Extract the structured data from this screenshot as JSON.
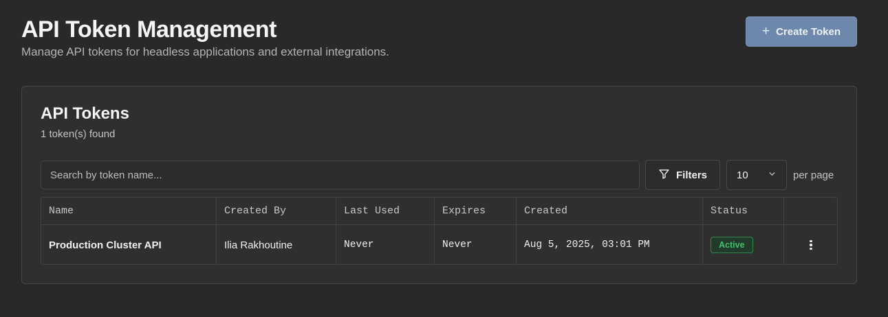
{
  "header": {
    "title": "API Token Management",
    "subtitle": "Manage API tokens for headless applications and external integrations.",
    "create_button": {
      "label": "Create Token",
      "icon": "plus-icon"
    }
  },
  "card": {
    "title": "API Tokens",
    "count_text": "1 token(s) found",
    "search": {
      "placeholder": "Search by token name...",
      "value": ""
    },
    "filters_button": {
      "label": "Filters",
      "icon": "filter-icon"
    },
    "per_page": {
      "value": "10",
      "label": "per page"
    }
  },
  "table": {
    "columns": [
      "Name",
      "Created By",
      "Last Used",
      "Expires",
      "Created",
      "Status",
      ""
    ],
    "rows": [
      {
        "name": "Production Cluster API",
        "created_by": "Ilia Rakhoutine",
        "last_used": "Never",
        "expires": "Never",
        "created": "Aug 5, 2025, 03:01 PM",
        "status": "Active",
        "actions_icon": "more-vertical-icon"
      }
    ]
  },
  "colors": {
    "background": "#292929",
    "card": "#2f2f2f",
    "primary_button": "#6e88ad",
    "status_active": "#44c06b"
  }
}
